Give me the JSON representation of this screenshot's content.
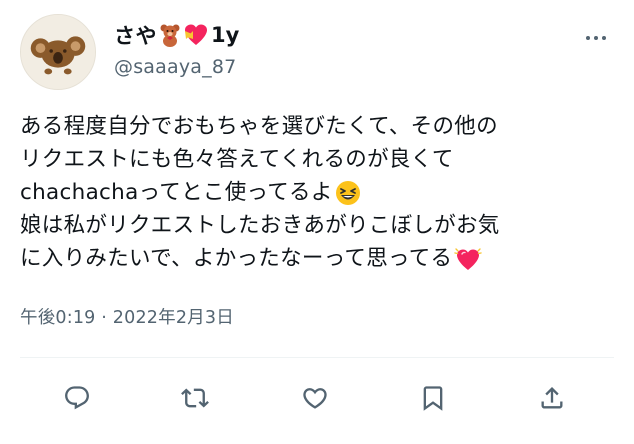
{
  "tweet": {
    "author": {
      "display_name": "さや",
      "name_emojis": [
        "teddy-bear",
        "heart-with-ribbon"
      ],
      "name_suffix": "1y",
      "handle": "@saaaya_87"
    },
    "text_lines": [
      "ある程度自分でおもちゃを選びたくて、その他の",
      "リクエストにも色々答えてくれるのが良くて",
      "chachachaってとこ使ってるよ",
      "娘は私がリクエストしたおきあがりこぼしがお気",
      "に入りみたいで、よかったなーって思ってる"
    ],
    "inline_emojis": {
      "line3": "grinning-squinting-face",
      "line5": "beating-heart"
    },
    "timestamp": "午後0:19 · 2022年2月3日"
  },
  "actions": [
    {
      "name": "reply",
      "icon": "reply-icon"
    },
    {
      "name": "retweet",
      "icon": "retweet-icon"
    },
    {
      "name": "like",
      "icon": "heart-icon"
    },
    {
      "name": "bookmark",
      "icon": "bookmark-icon"
    },
    {
      "name": "share",
      "icon": "share-icon"
    }
  ],
  "colors": {
    "text": "#0f1419",
    "secondary": "#536471",
    "divider": "#eff3f4",
    "heart_red": "#f4245e"
  }
}
